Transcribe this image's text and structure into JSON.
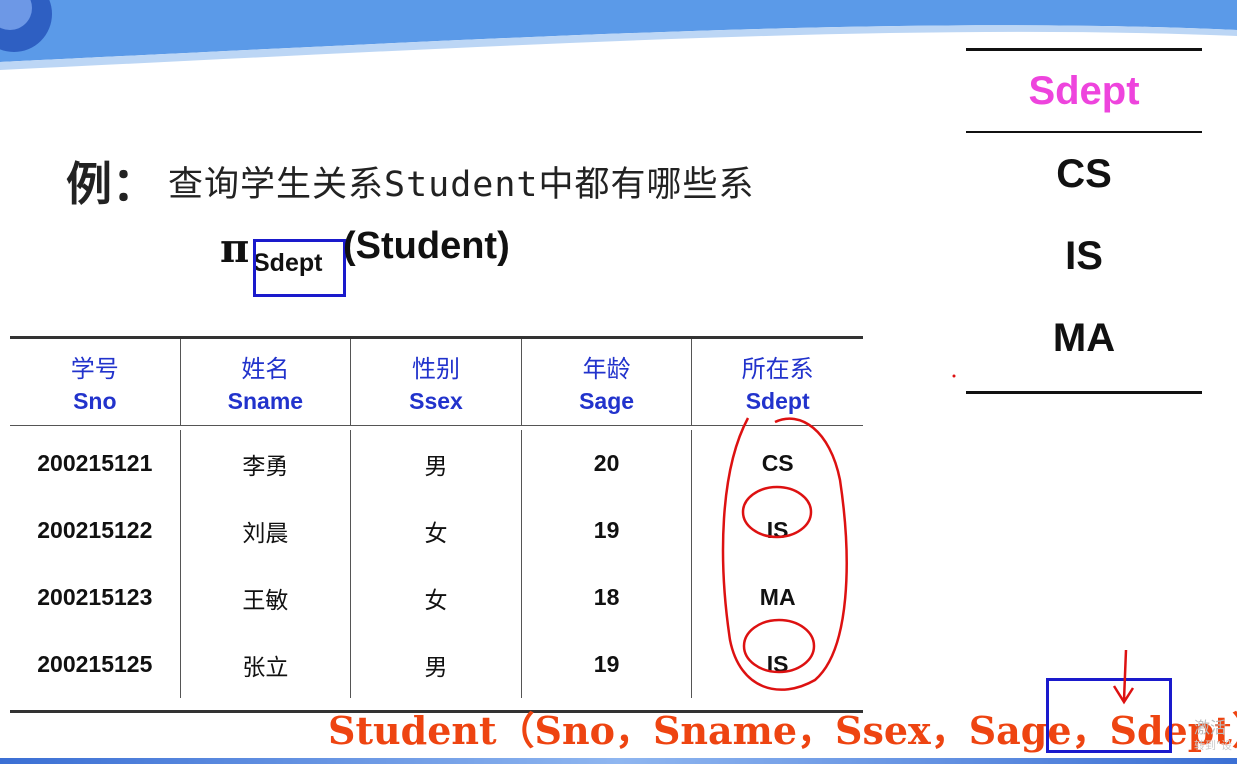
{
  "example": {
    "label": "例：",
    "text": "查询学生关系Student中都有哪些系"
  },
  "expression": {
    "symbol": "π",
    "subscript": "Sdept",
    "argument": "(Student)"
  },
  "table": {
    "headers": [
      {
        "zh": "学号",
        "en": "Sno"
      },
      {
        "zh": "姓名",
        "en": "Sname"
      },
      {
        "zh": "性别",
        "en": "Ssex"
      },
      {
        "zh": "年龄",
        "en": "Sage"
      },
      {
        "zh": "所在系",
        "en": "Sdept"
      }
    ],
    "rows": [
      [
        "200215121",
        "李勇",
        "男",
        "20",
        "CS"
      ],
      [
        "200215122",
        "刘晨",
        "女",
        "19",
        "IS"
      ],
      [
        "200215123",
        "王敏",
        "女",
        "18",
        "MA"
      ],
      [
        "200215125",
        "张立",
        "男",
        "19",
        "IS"
      ]
    ]
  },
  "result": {
    "header": "Sdept",
    "values": [
      "CS",
      "IS",
      "MA"
    ]
  },
  "schema": {
    "text": "Student（Sno，Sname，Ssex，Sage，Sdept）"
  },
  "watermark": {
    "line1": "激活",
    "line2": "转到\"设"
  },
  "colors": {
    "header_blue": "#2233cc",
    "result_header_pink": "#ee44dd",
    "schema_orange": "#ee4411",
    "box_blue": "#1a1acc",
    "annotation_red": "#dd1111"
  }
}
